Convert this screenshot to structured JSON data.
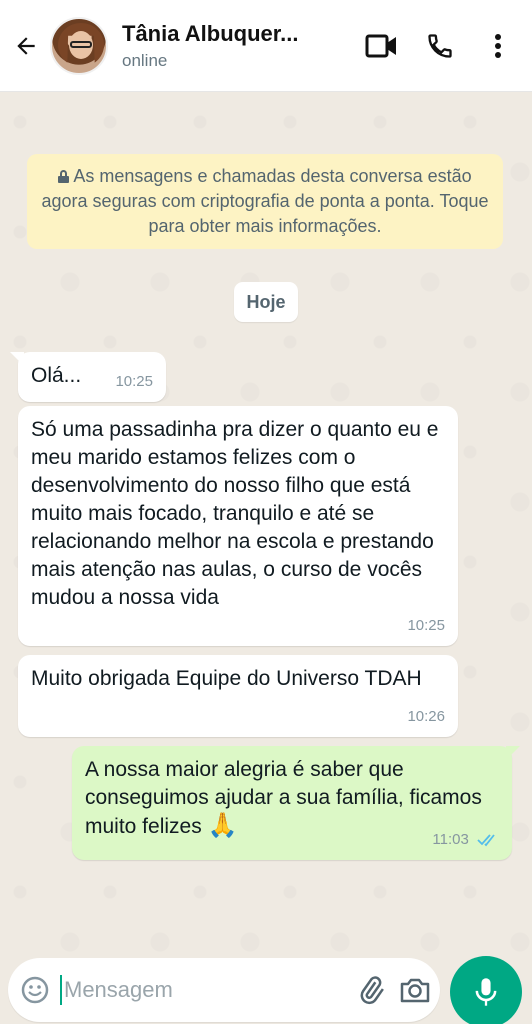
{
  "header": {
    "contact_name": "Tânia Albuquer...",
    "status": "online",
    "icons": [
      "back-arrow-icon",
      "video-call-icon",
      "phone-icon",
      "more-options-icon"
    ]
  },
  "chat": {
    "encryption_notice": "As mensagens e chamadas desta conversa estão agora seguras com criptografia de ponta a ponta. Toque para obter mais informações.",
    "date_chip": "Hoje",
    "messages": [
      {
        "direction": "in",
        "text": "Olá...",
        "time": "10:25"
      },
      {
        "direction": "in",
        "text": "Só uma passadinha pra dizer o quanto eu e meu marido estamos felizes com o desenvolvimento do nosso filho que está muito mais focado, tranquilo e até se relacionando melhor na escola e prestando mais atenção nas aulas, o curso de vocês mudou a nossa vida",
        "time": "10:25"
      },
      {
        "direction": "in",
        "text": "Muito obrigada Equipe do Universo TDAH",
        "time": "10:26"
      },
      {
        "direction": "out",
        "text": "A nossa maior alegria é saber que conseguimos ajudar a sua família, ficamos muito felizes",
        "emoji": "🙏",
        "time": "11:03",
        "status": "read"
      }
    ]
  },
  "composer": {
    "placeholder": "Mensagem",
    "icons": [
      "emoji-icon",
      "attach-icon",
      "camera-icon",
      "mic-icon"
    ]
  },
  "colors": {
    "accent": "#00a884",
    "outgoing_bubble": "#dcf8c6",
    "notice_bg": "#fdf3c4",
    "read_ticks": "#53bdeb"
  }
}
